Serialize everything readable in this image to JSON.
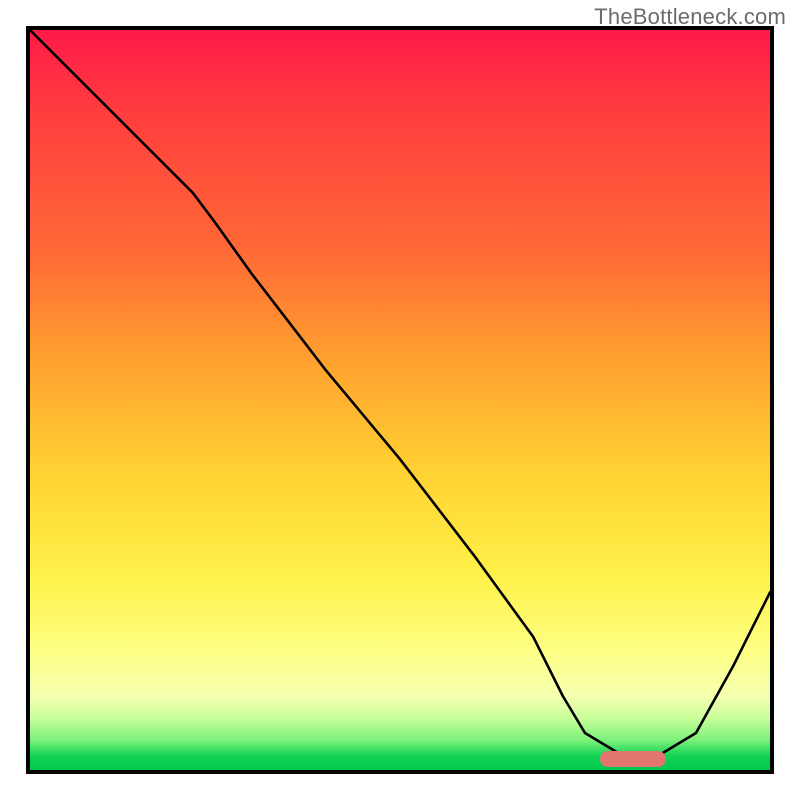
{
  "source_label": "TheBottleneck.com",
  "chart_data": {
    "type": "line",
    "title": "",
    "xlabel": "",
    "ylabel": "",
    "xlim": [
      0,
      100
    ],
    "ylim": [
      0,
      100
    ],
    "x": [
      0,
      8,
      15,
      22,
      25,
      30,
      40,
      50,
      60,
      68,
      72,
      75,
      80,
      85,
      90,
      95,
      100
    ],
    "values": [
      100,
      92,
      85,
      78,
      74,
      67,
      54,
      42,
      29,
      18,
      10,
      5,
      2,
      2,
      5,
      14,
      24
    ],
    "gradient_stops": [
      {
        "pct": 0,
        "color": "#ff1a48"
      },
      {
        "pct": 30,
        "color": "#ff6a36"
      },
      {
        "pct": 60,
        "color": "#ffd233"
      },
      {
        "pct": 85,
        "color": "#fdff84"
      },
      {
        "pct": 96,
        "color": "#7cf07a"
      },
      {
        "pct": 100,
        "color": "#00c84e"
      }
    ],
    "marker": {
      "x_start": 77,
      "x_end": 86,
      "y": 1.5,
      "color": "#e2766f"
    }
  }
}
